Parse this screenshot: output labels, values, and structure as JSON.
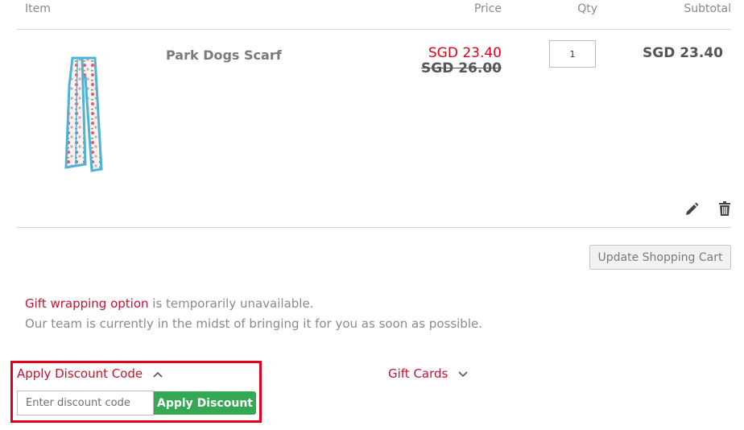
{
  "table_header": {
    "item": "Item",
    "price": "Price",
    "qty": "Qty",
    "subtotal": "Subtotal"
  },
  "cart_item": {
    "name": "Park Dogs Scarf",
    "sale_price": "SGD 23.40",
    "original_price": "SGD 26.00",
    "qty": "1",
    "subtotal": "SGD 23.40",
    "image_icon": "scarf-image"
  },
  "actions": {
    "edit_icon": "pencil-icon",
    "delete_icon": "trash-icon",
    "update_cart_label": "Update Shopping Cart"
  },
  "notice": {
    "gift_wrapping_link": "Gift wrapping option",
    "line1_rest": " is temporarily unavailable.",
    "line2": "Our team is currently in the midst of bringing it for you as soon as possible."
  },
  "discount": {
    "toggle_label": "Apply Discount Code",
    "input_placeholder": "Enter discount code",
    "apply_label": "Apply Discount",
    "expanded_icon": "chevron-up-icon"
  },
  "gift_cards": {
    "toggle_label": "Gift Cards",
    "collapsed_icon": "chevron-down-icon"
  },
  "colors": {
    "accent_red": "#c8102e",
    "sale_red": "#e2001a",
    "apply_green": "#34a853"
  }
}
